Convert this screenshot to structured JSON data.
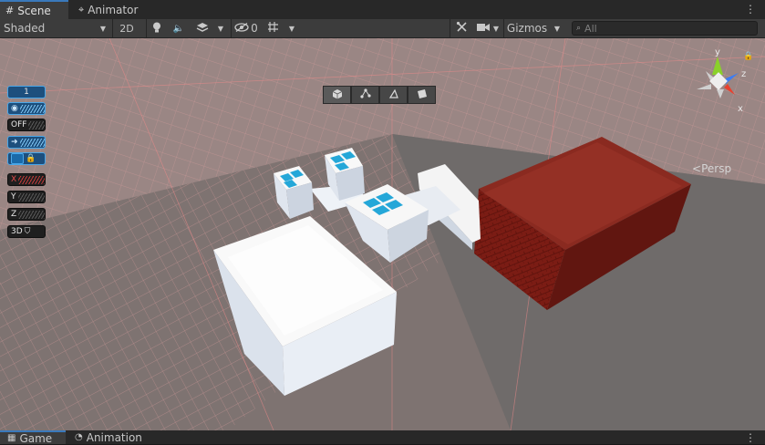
{
  "tabs": [
    {
      "label": "Scene",
      "icon": "hash-grid-icon",
      "active": true
    },
    {
      "label": "Animator",
      "icon": "animator-icon",
      "active": false
    }
  ],
  "toolbar": {
    "shading_mode": "Shaded",
    "mode_2d": "2D",
    "hidden_count": "0",
    "gizmos": "Gizmos",
    "search_placeholder": "All"
  },
  "overlay": {
    "layer_count": "1",
    "off_label": "OFF",
    "x_label": "X",
    "y_label": "Y",
    "z_label": "Z",
    "label_3d": "3D"
  },
  "gizmo": {
    "axis_y": "y",
    "axis_z": "z",
    "axis_x": "x",
    "projection": "Persp",
    "colors": {
      "x": "#e8412f",
      "y": "#8ad12a",
      "z": "#3d7cf2"
    }
  },
  "bottom_tabs": [
    {
      "label": "Game",
      "icon": "game-icon",
      "active": true
    },
    {
      "label": "Animation",
      "icon": "animation-icon",
      "active": false
    }
  ],
  "colors": {
    "accent": "#3a79bb",
    "roof": "#7d1f17",
    "grid": "#f08a8a"
  }
}
